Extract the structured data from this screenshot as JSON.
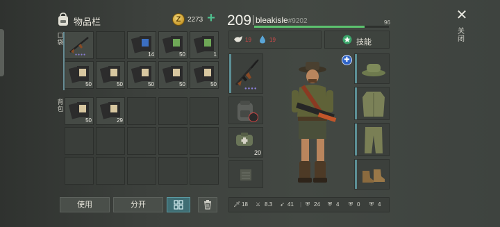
{
  "inventory": {
    "title": "物品栏",
    "coins": "2273",
    "pocket_label": "口袋",
    "backpack_label": "背包",
    "pocket_slots": [
      {
        "item": "ak-rifle",
        "count": ""
      },
      {
        "item": "empty",
        "count": ""
      },
      {
        "item": "skill-book-blue",
        "count": "14"
      },
      {
        "item": "skill-book-green",
        "count": "50"
      },
      {
        "item": "skill-book-green",
        "count": "1"
      },
      {
        "item": "skill-book-tan",
        "count": "50"
      },
      {
        "item": "skill-book-tan",
        "count": "50"
      },
      {
        "item": "skill-book-tan",
        "count": "50"
      },
      {
        "item": "skill-book-tan",
        "count": "50"
      },
      {
        "item": "skill-book-tan",
        "count": "50"
      }
    ],
    "backpack_slots": [
      {
        "item": "skill-book-tan",
        "count": "50"
      },
      {
        "item": "skill-book-tan",
        "count": "29"
      },
      {
        "item": "empty",
        "count": ""
      },
      {
        "item": "empty",
        "count": ""
      },
      {
        "item": "empty",
        "count": ""
      },
      {
        "item": "empty",
        "count": ""
      },
      {
        "item": "empty",
        "count": ""
      },
      {
        "item": "empty",
        "count": ""
      },
      {
        "item": "empty",
        "count": ""
      },
      {
        "item": "empty",
        "count": ""
      },
      {
        "item": "empty",
        "count": ""
      },
      {
        "item": "empty",
        "count": ""
      },
      {
        "item": "empty",
        "count": ""
      },
      {
        "item": "empty",
        "count": ""
      },
      {
        "item": "empty",
        "count": ""
      }
    ],
    "buttons": {
      "use": "使用",
      "split": "分开"
    }
  },
  "player": {
    "level": "209",
    "name": "bleakisle",
    "id": "#9202",
    "xp_value": "96",
    "xp_progress": 0.82,
    "food": "19",
    "water": "19",
    "skills_label": "技能",
    "ammo_count": "20"
  },
  "stats": {
    "damage": "18",
    "speed": "8.3",
    "attack": "41",
    "armor": "24",
    "resist": "4",
    "bio": "0",
    "other": "4"
  },
  "close_label": "关闭",
  "colors": {
    "accent_green": "#4fbf8e",
    "xp_green": "#5cc26e",
    "health_red": "#d24a4a",
    "water_blue": "#5aa6d8",
    "slot_blue": "#5c8f95"
  }
}
